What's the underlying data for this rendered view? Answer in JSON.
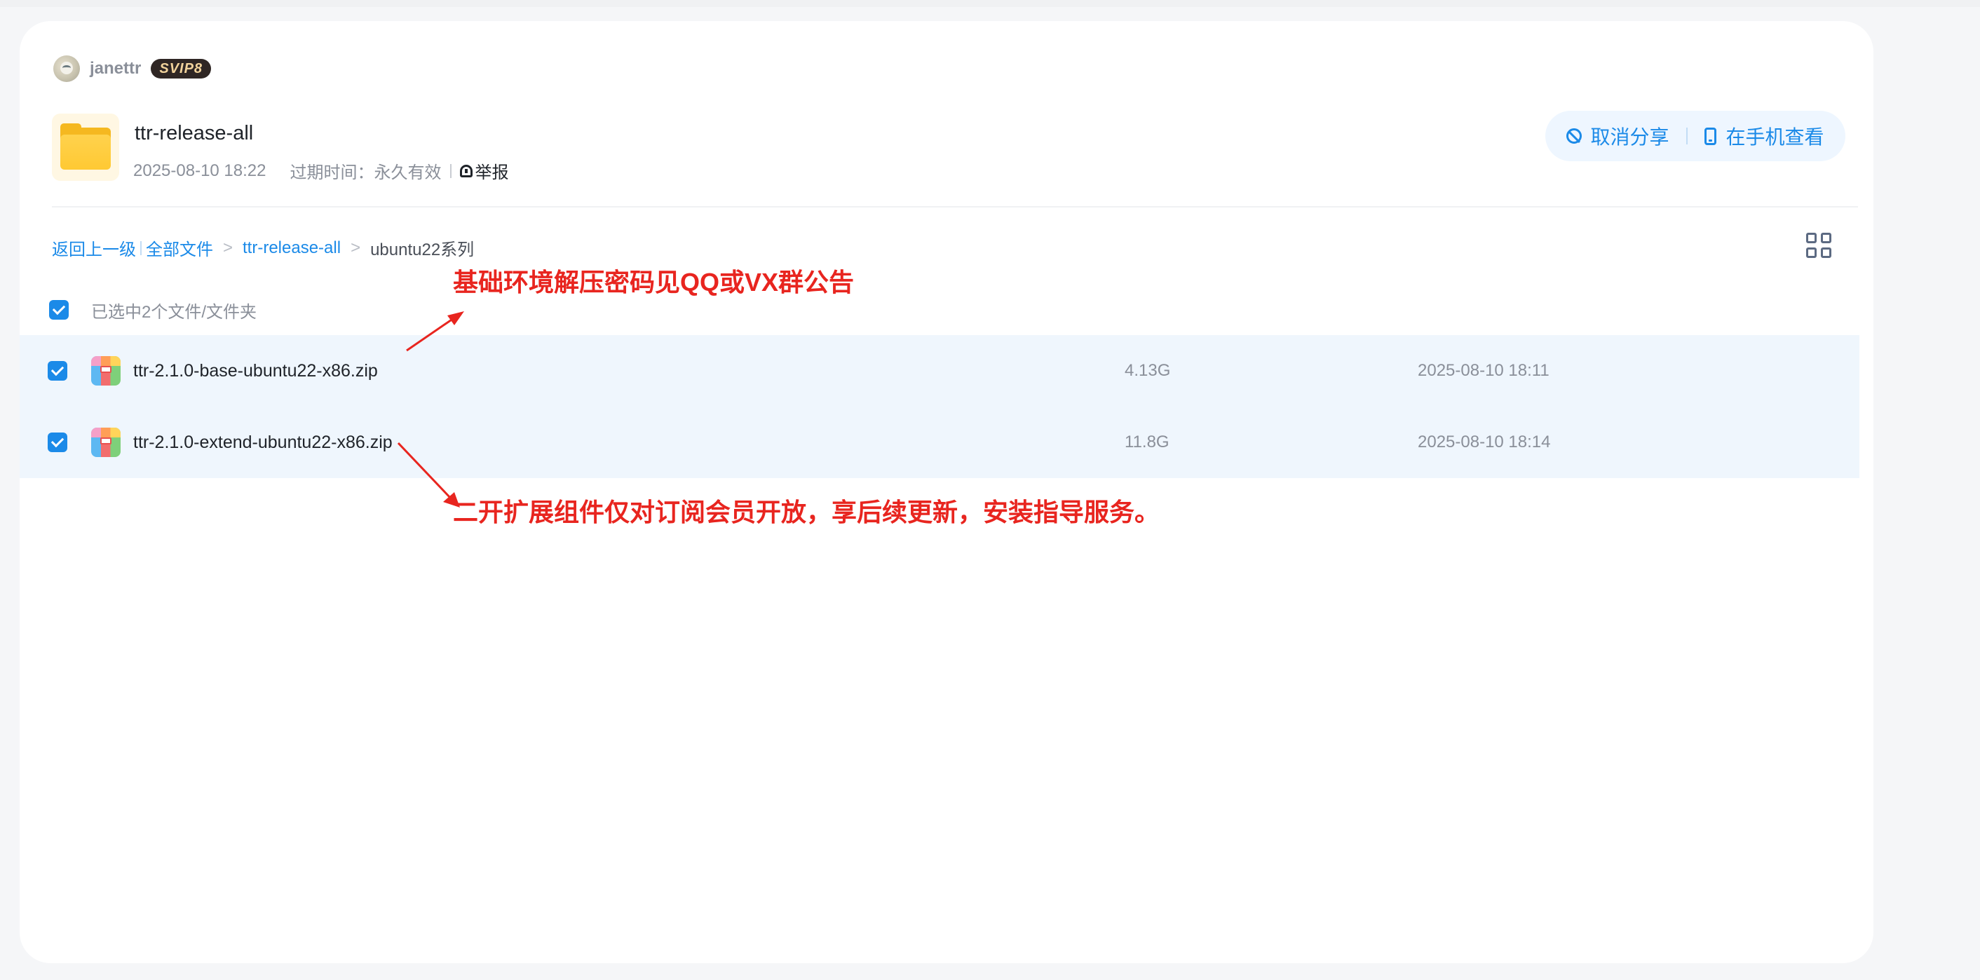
{
  "user": {
    "name": "janettr",
    "badge": "SVIP8"
  },
  "folder": {
    "title": "ttr-release-all",
    "created": "2025-08-10 18:22",
    "expire_label": "过期时间：永久有效",
    "report_label": "举报"
  },
  "actions": {
    "cancel_share": "取消分享",
    "view_on_phone": "在手机查看"
  },
  "breadcrumb": {
    "back": "返回上一级",
    "all_files": "全部文件",
    "parent": "ttr-release-all",
    "current": "ubuntu22系列",
    "arrow": ">"
  },
  "selection": {
    "text": "已选中2个文件/文件夹"
  },
  "files": [
    {
      "name": "ttr-2.1.0-base-ubuntu22-x86.zip",
      "size": "4.13G",
      "date": "2025-08-10 18:11",
      "checked": true
    },
    {
      "name": "ttr-2.1.0-extend-ubuntu22-x86.zip",
      "size": "11.8G",
      "date": "2025-08-10 18:14",
      "checked": true
    }
  ],
  "annotations": {
    "top": "基础环境解压密码见QQ或VX群公告",
    "bottom": "二开扩展组件仅对订阅会员开放，享后续更新，安装指导服务。"
  },
  "colors": {
    "accent": "#1b8ae8",
    "annotation": "#e8251f",
    "row_selected": "#eff6fd"
  }
}
